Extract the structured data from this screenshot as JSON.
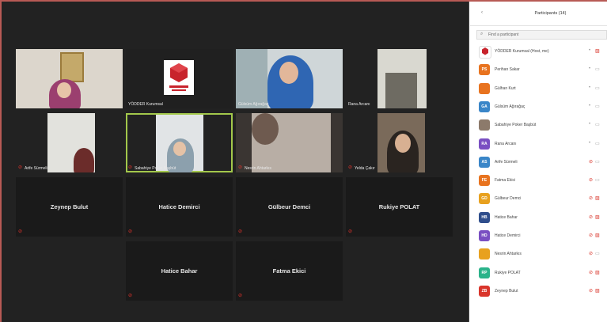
{
  "video_tiles": [
    {
      "name": "",
      "muted": false
    },
    {
      "name": "YÖDDER Kurumsal",
      "muted": false
    },
    {
      "name": "Gülsüm Ağırağaç",
      "muted": false
    },
    {
      "name": "Rana Arcanı",
      "muted": false
    },
    {
      "name": "Arife Sürmeli",
      "muted": true
    },
    {
      "name": "Sabahiye Poker Başbüt",
      "muted": true
    },
    {
      "name": "Nesrin Ahtarkıs",
      "muted": true
    },
    {
      "name": "Yelda Çakır",
      "muted": true
    }
  ],
  "name_tiles": [
    {
      "name": "Zeynep Bulut",
      "muted": true
    },
    {
      "name": "Hatice Demirci",
      "muted": true
    },
    {
      "name": "Gülbeur Demci",
      "muted": true
    },
    {
      "name": "Rukiye POLAT",
      "muted": true
    },
    {
      "name": "Hatice Bahar",
      "muted": true
    },
    {
      "name": "Fatma Ekici",
      "muted": true
    }
  ],
  "panel": {
    "title": "Participants (14)",
    "search_placeholder": "Find a participant",
    "participants": [
      {
        "initials": "",
        "name": "YÖDDER Kurumsal (Host, me)",
        "color": "#ffffff",
        "mic_off": false,
        "cam_off": true
      },
      {
        "initials": "PS",
        "name": "Perihan Sakar",
        "color": "#e8731f",
        "mic_off": false,
        "cam_off": false
      },
      {
        "initials": "",
        "name": "Gülhan Kurt",
        "color": "#e8731f",
        "mic_off": false,
        "cam_off": false
      },
      {
        "initials": "GA",
        "name": "Gülsüm Ağırağaç",
        "color": "#3a86c8",
        "mic_off": false,
        "cam_off": false
      },
      {
        "initials": "",
        "name": "Sabahiye Poker Başbüt",
        "color": "#8c7a6b",
        "mic_off": false,
        "cam_off": false
      },
      {
        "initials": "RA",
        "name": "Rana Arcanı",
        "color": "#7a4fc2",
        "mic_off": false,
        "cam_off": false
      },
      {
        "initials": "AS",
        "name": "Arife Sürmeli",
        "color": "#3a86c8",
        "mic_off": true,
        "cam_off": false
      },
      {
        "initials": "FE",
        "name": "Fatma Ekici",
        "color": "#e8731f",
        "mic_off": true,
        "cam_off": false
      },
      {
        "initials": "GD",
        "name": "Gülbeur Demci",
        "color": "#e8a11f",
        "mic_off": true,
        "cam_off": true
      },
      {
        "initials": "HB",
        "name": "Hatice Bahar",
        "color": "#2f4e8c",
        "mic_off": true,
        "cam_off": true
      },
      {
        "initials": "HD",
        "name": "Hatice Demirci",
        "color": "#7a4fc2",
        "mic_off": true,
        "cam_off": true
      },
      {
        "initials": "",
        "name": "Nesrin Ahtarkıs",
        "color": "#e8a11f",
        "mic_off": true,
        "cam_off": false
      },
      {
        "initials": "RP",
        "name": "Rukiye POLAT",
        "color": "#2bb38a",
        "mic_off": true,
        "cam_off": true
      },
      {
        "initials": "ZB",
        "name": "Zeynep Bulut",
        "color": "#d9352b",
        "mic_off": true,
        "cam_off": true
      }
    ]
  }
}
